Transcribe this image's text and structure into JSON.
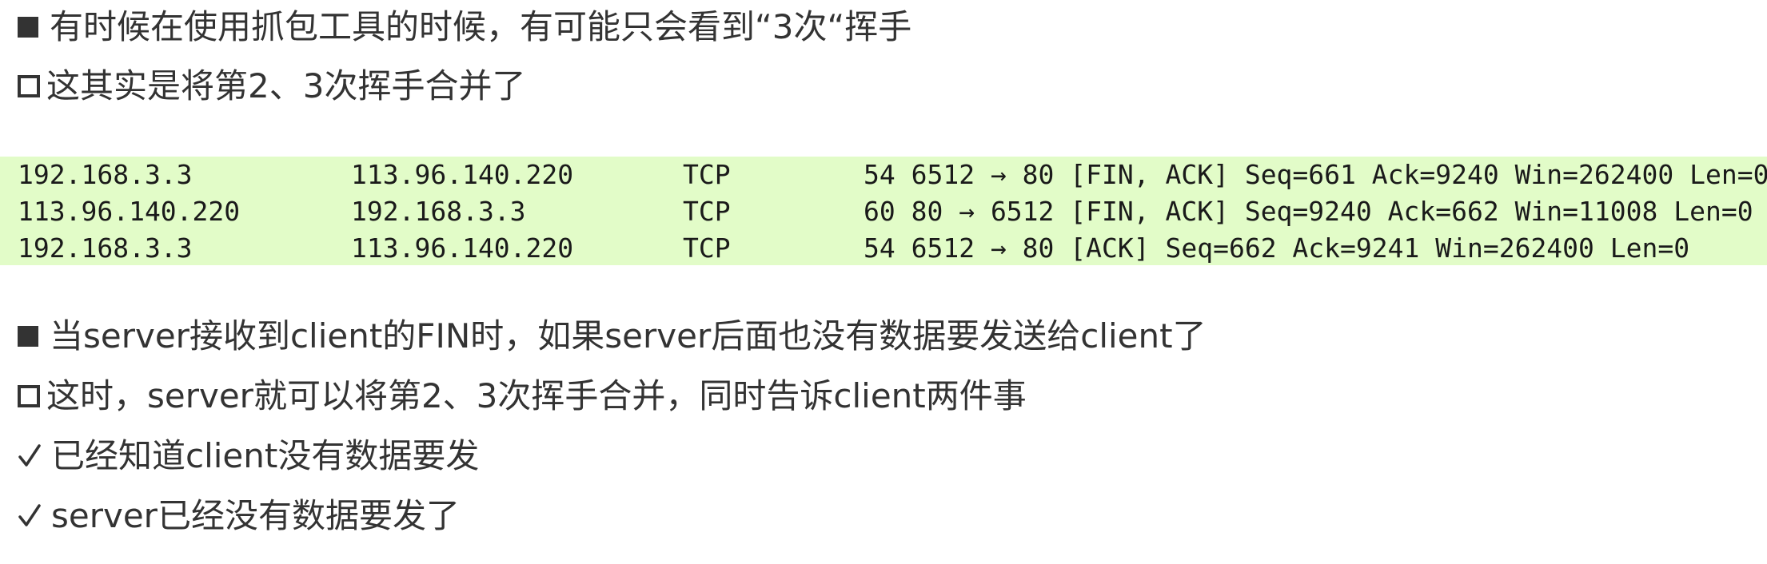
{
  "slide": {
    "top_lines": [
      {
        "bullet": "filled-square",
        "text": "有时候在使用抓包工具的时候，有可能只会看到“3次“挥手"
      },
      {
        "bullet": "hollow-square",
        "text": "这其实是将第2、3次挥手合并了"
      }
    ],
    "capture": {
      "row_background": "#e2fcc8",
      "rows": [
        {
          "source": "192.168.3.3",
          "destination": "113.96.140.220",
          "protocol": "TCP",
          "info": "54 6512 → 80 [FIN, ACK] Seq=661 Ack=9240 Win=262400 Len=0"
        },
        {
          "source": "113.96.140.220",
          "destination": "192.168.3.3",
          "protocol": "TCP",
          "info": "60 80 → 6512 [FIN, ACK] Seq=9240 Ack=662 Win=11008 Len=0"
        },
        {
          "source": "192.168.3.3",
          "destination": "113.96.140.220",
          "protocol": "TCP",
          "info": "54 6512 → 80 [ACK] Seq=662 Ack=9241 Win=262400 Len=0"
        }
      ]
    },
    "bottom_lines": [
      {
        "bullet": "filled-square",
        "text": "当server接收到client的FIN时，如果server后面也没有数据要发送给client了"
      },
      {
        "bullet": "hollow-square",
        "text": "这时，server就可以将第2、3次挥手合并，同时告诉client两件事"
      },
      {
        "bullet": "check-mark",
        "text": "已经知道client没有数据要发"
      },
      {
        "bullet": "check-mark",
        "text": "server已经没有数据要发了"
      }
    ]
  }
}
